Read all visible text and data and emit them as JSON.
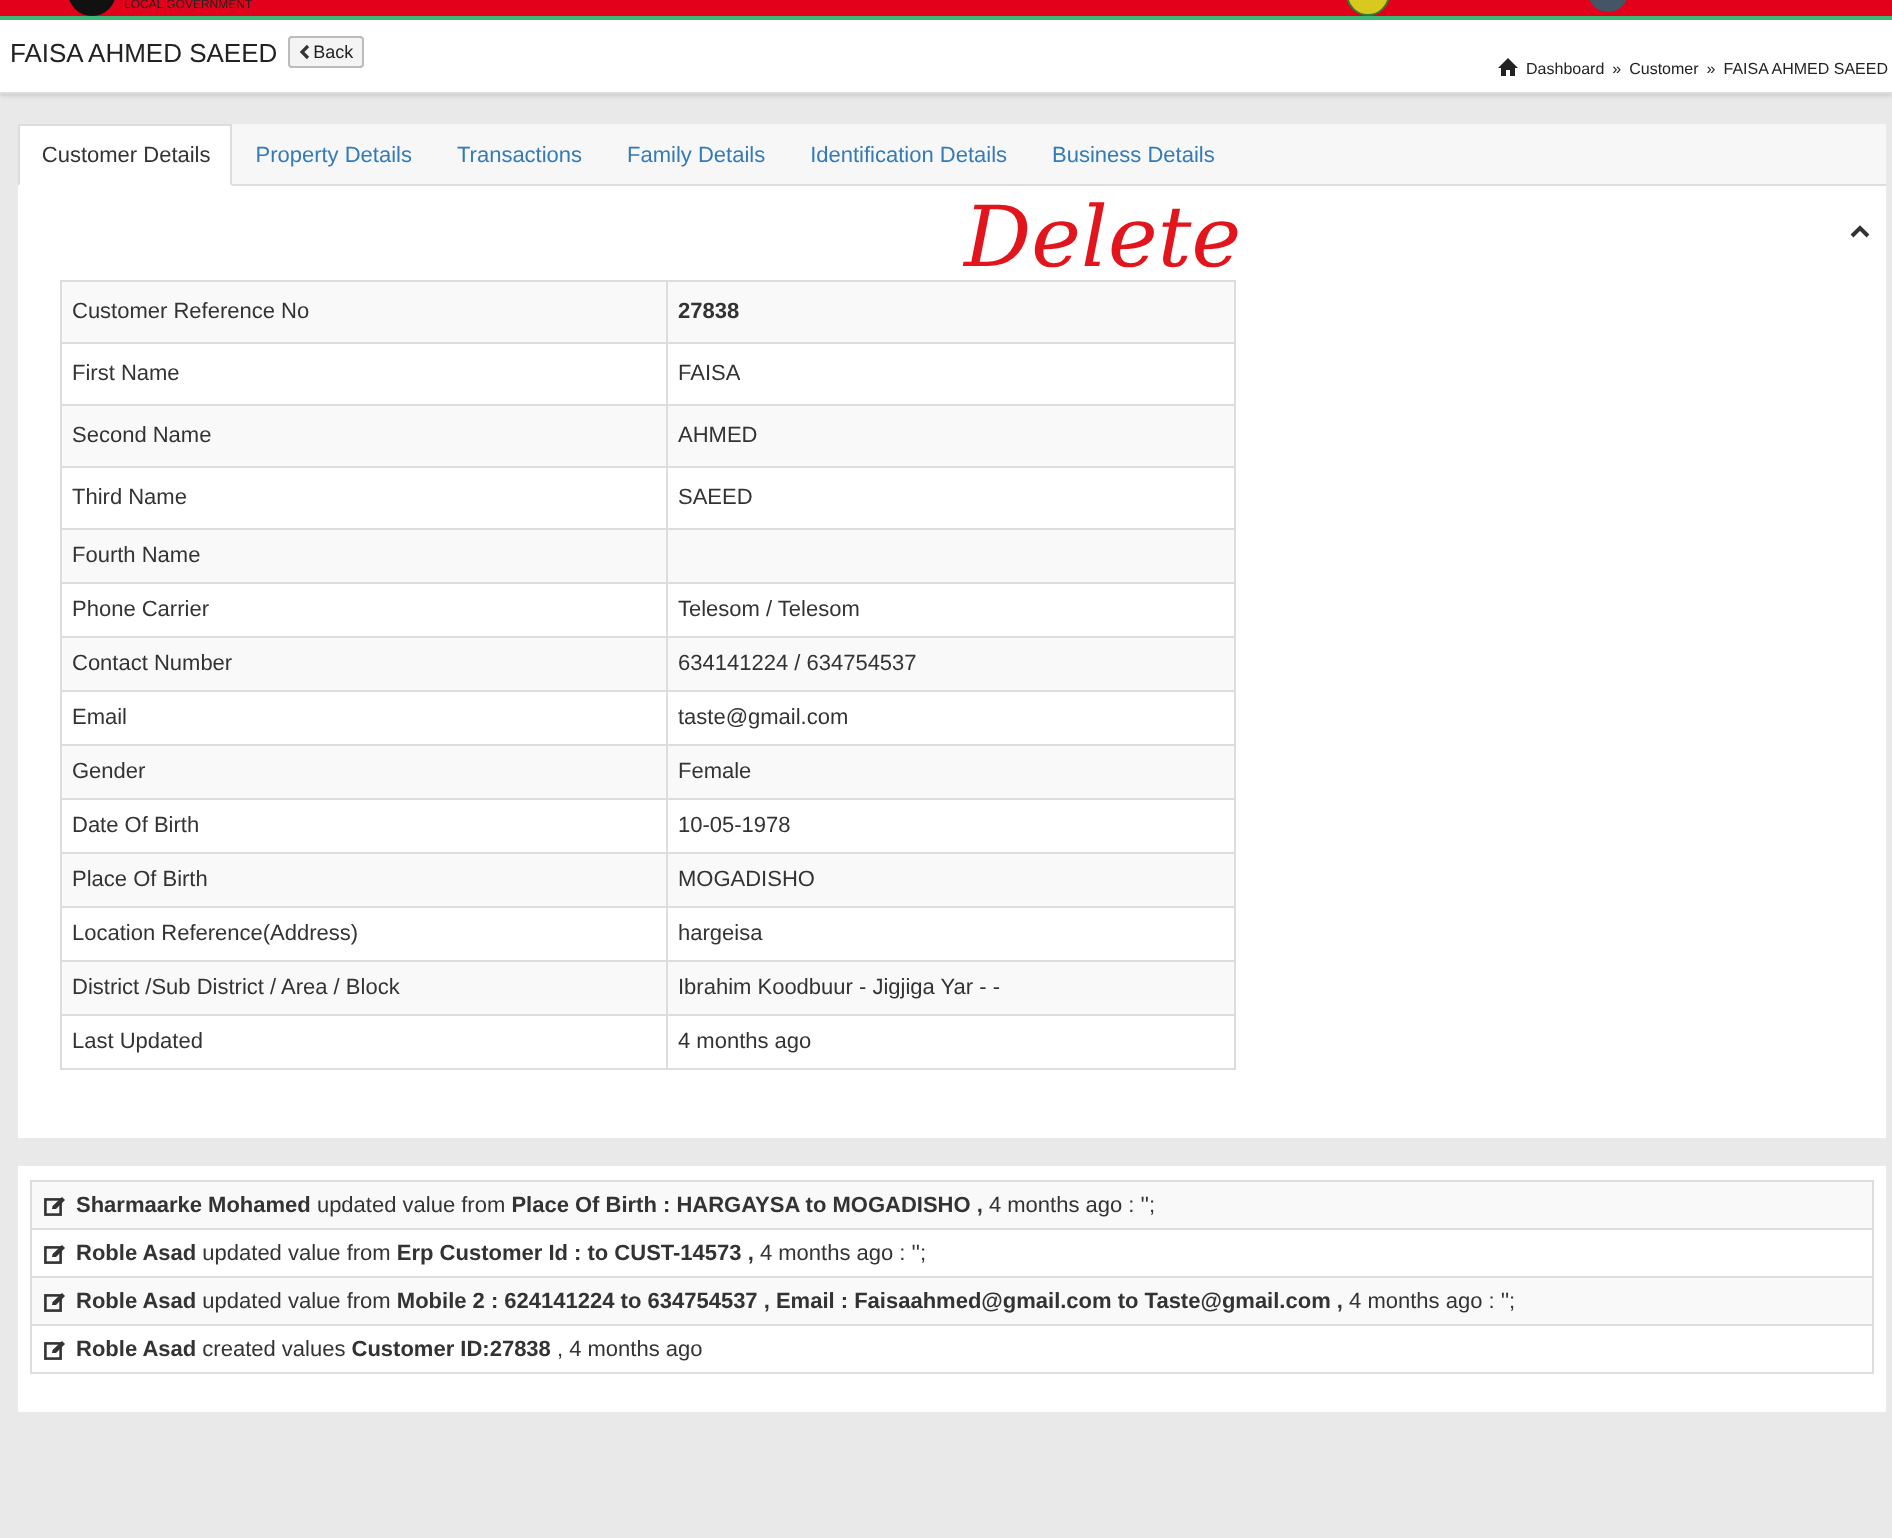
{
  "header": {
    "logo_text": "LOCAL GOVERNMENT"
  },
  "page": {
    "title": "FAISA AHMED SAEED",
    "back_button": "Back",
    "breadcrumb": [
      "Dashboard",
      "Customer",
      "FAISA AHMED SAEED"
    ],
    "separator": "»"
  },
  "tabs": [
    {
      "label": "Customer Details",
      "selected": true
    },
    {
      "label": "Property Details",
      "selected": false
    },
    {
      "label": "Transactions",
      "selected": false
    },
    {
      "label": "Family Details",
      "selected": false
    },
    {
      "label": "Identification Details",
      "selected": false
    },
    {
      "label": "Business Details",
      "selected": false
    }
  ],
  "annotation": "Delete",
  "reference": {
    "label": "Customer Reference No",
    "value": "27838"
  },
  "details": [
    {
      "label": "First Name",
      "value": "FAISA"
    },
    {
      "label": "Second Name",
      "value": "AHMED"
    },
    {
      "label": "Third Name",
      "value": "SAEED"
    },
    {
      "label": "Fourth Name"
    },
    {
      "label": "Phone Carrier",
      "value": "Telesom / Telesom"
    },
    {
      "label": "Contact Number",
      "value": "634141224 / 634754537"
    },
    {
      "label": "Email",
      "value": "taste@gmail.com"
    },
    {
      "label": "Gender",
      "value": "Female"
    },
    {
      "label": "Date Of Birth",
      "value": "10-05-1978"
    },
    {
      "label": "Place Of Birth",
      "value": "MOGADISHO"
    },
    {
      "label": "Location Reference(Address)",
      "value": "hargeisa"
    },
    {
      "label": "District /Sub District / Area / Block",
      "value": "Ibrahim Koodbuur - Jigjiga Yar - -"
    },
    {
      "label": "Last Updated",
      "value": "4 months ago"
    }
  ],
  "history": [
    "**Sharmaarke Mohamed** updated value from **Place Of Birth : HARGAYSA to MOGADISHO ,** 4 months ago : '';",
    "**Roble Asad** updated value from **Erp Customer Id : to CUST-14573 ,** 4 months ago : '';",
    "**Roble Asad** updated value from **Mobile 2 : 624141224 to 634754537 , Email : Faisaahmed@gmail.com to Taste@gmail.com ,** 4 months ago : '';",
    "**Roble Asad** created values **Customer ID:27838** , 4 months ago"
  ]
}
